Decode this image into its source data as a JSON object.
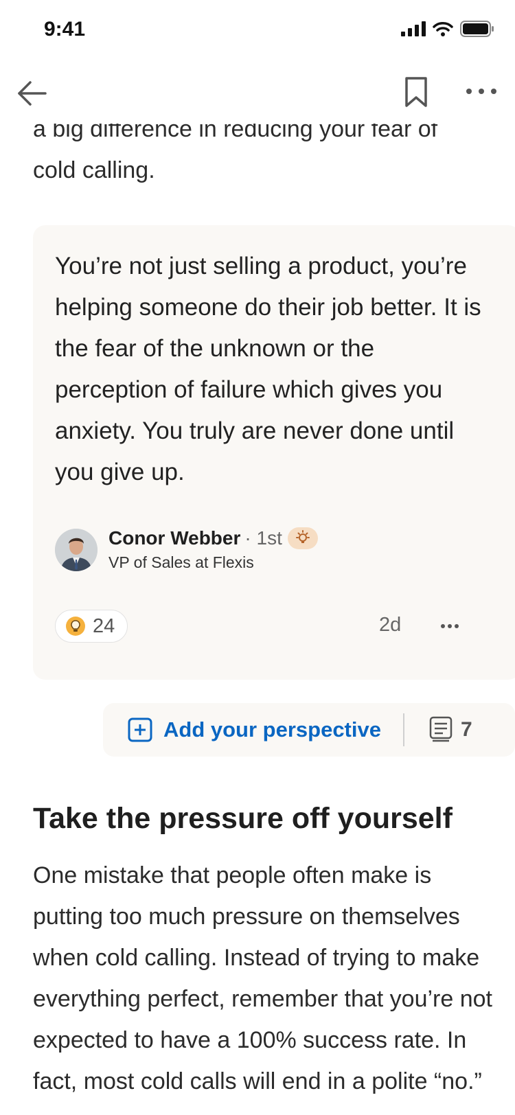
{
  "status_bar": {
    "time": "9:41"
  },
  "article": {
    "lead_text": "a big difference in reducing your fear of cold calling.",
    "quote": {
      "text": "You’re not just selling a product, you’re helping someone do their job better. It is the fear of the unknown or the perception of failure which gives you anxiety. You truly are never done until you give up.",
      "author": {
        "name": "Conor Webber",
        "degree": "· 1st",
        "title": "VP of Sales at Flexis"
      },
      "reaction_count": "24",
      "time_ago": "2d"
    },
    "perspective": {
      "add_label": "Add your perspective",
      "comment_count": "7"
    },
    "section": {
      "heading": "Take the pressure off yourself",
      "body": "One mistake that people often make is putting too much pressure on themselves when cold calling. Instead of trying to make everything perfect, remember that you’re not expected to have a 100% success rate. In fact, most cold calls will end in a polite “no.”"
    }
  },
  "colors": {
    "accent": "#0a66c2",
    "card_bg": "#faf8f5",
    "badge_bg": "#f6ddc3"
  }
}
